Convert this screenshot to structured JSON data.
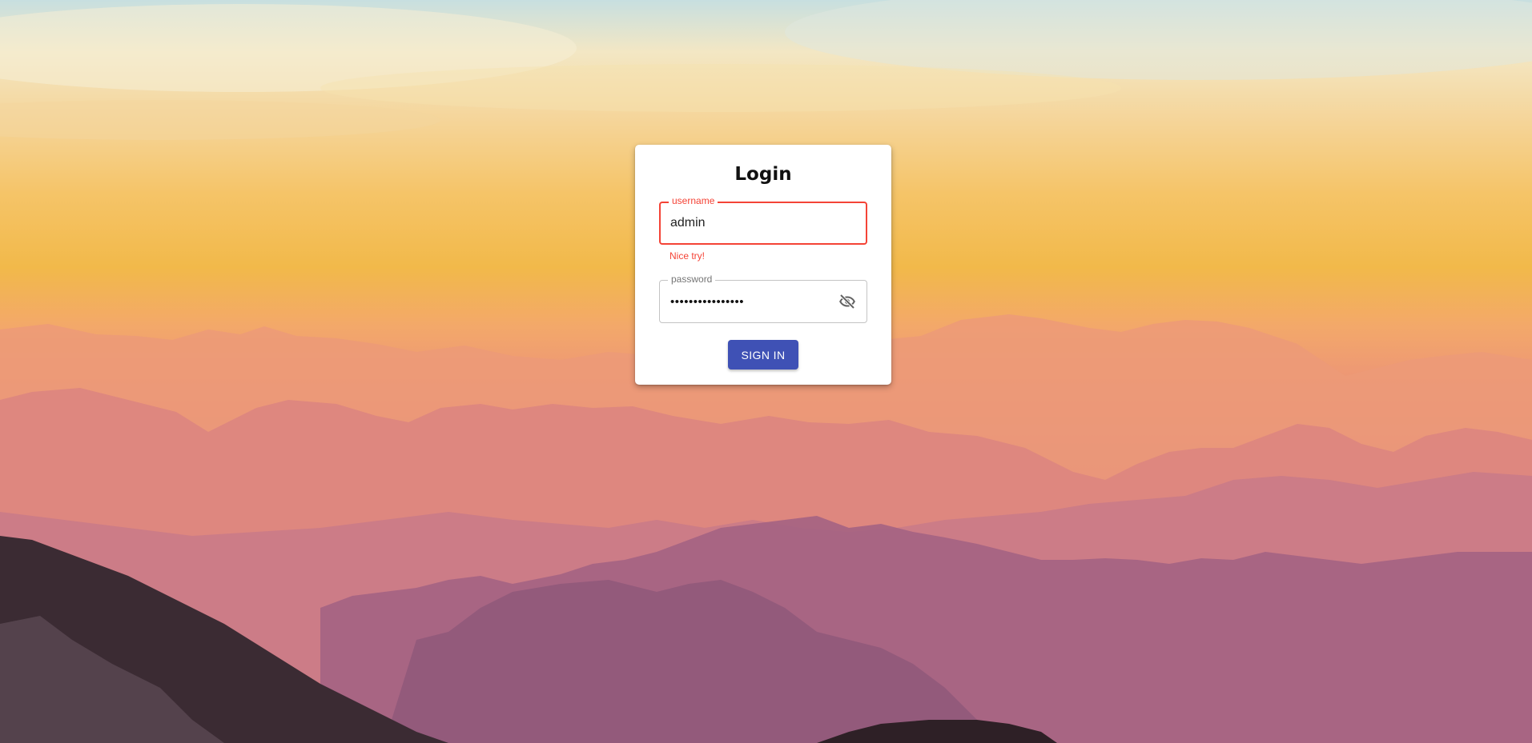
{
  "background": {
    "description_icon": "mountain-sunset-image",
    "colors": {
      "sky_top": "#c7dfe0",
      "sky_mid": "#f5c468",
      "ridge_far": "#e88f76",
      "ridge_near": "#9c5c7c",
      "foreground_rock": "#3a2a30"
    }
  },
  "login": {
    "title": "Login",
    "username": {
      "label": "username",
      "value": "admin",
      "helper_text": "Nice try!",
      "state": "error"
    },
    "password": {
      "label": "password",
      "value": "••••••••••••••••",
      "visibility_icon": "eye-off-icon"
    },
    "submit_label": "SIGN IN"
  },
  "colors": {
    "error": "#f44336",
    "primary": "#3f51b5",
    "card_bg": "#ffffff"
  }
}
